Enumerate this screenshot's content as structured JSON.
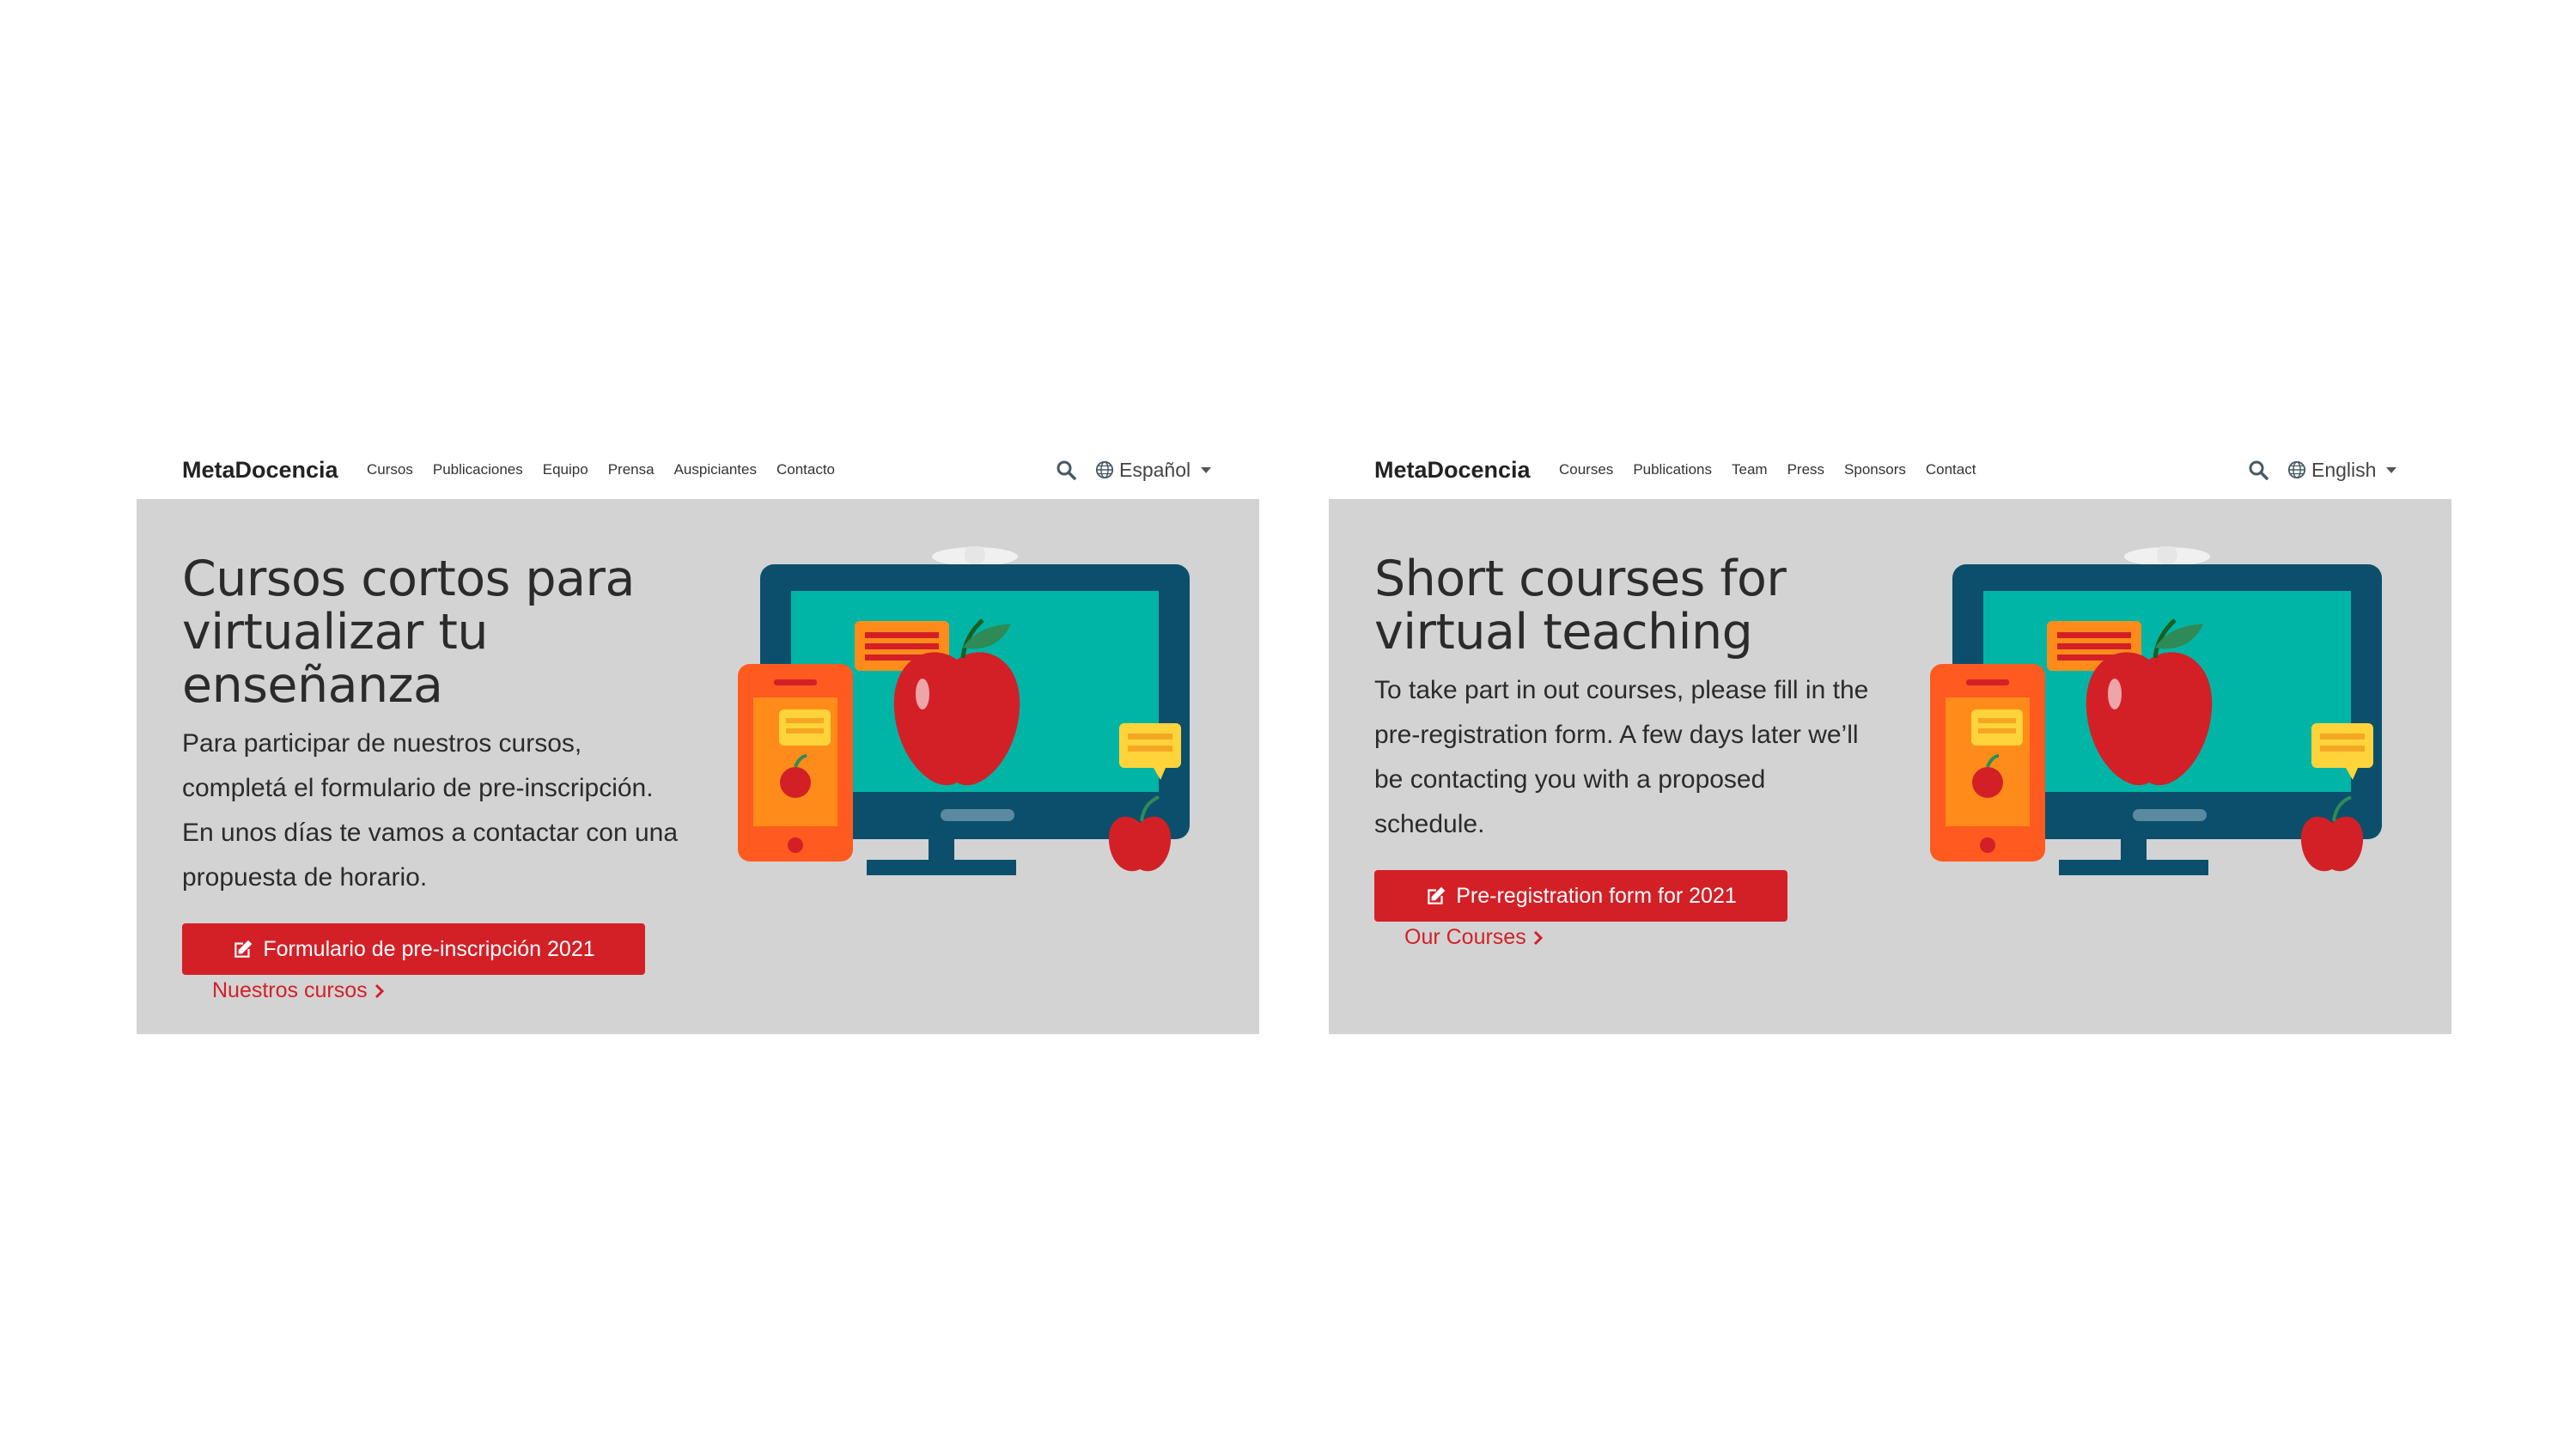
{
  "colors": {
    "page_background": "#ffffff",
    "hero_background": "#d3d3d3",
    "accent_red": "#d32027",
    "monitor_frame": "#0b4f6c",
    "screen_teal": "#00b5a5",
    "phone_orange": "#ff5a1f",
    "bubble_yellow": "#ffd43b",
    "apple_red": "#d32027",
    "leaf_green": "#2e8b57"
  },
  "panels": [
    {
      "id": "es",
      "brand": "MetaDocencia",
      "nav": [
        "Cursos",
        "Publicaciones",
        "Equipo",
        "Prensa",
        "Auspiciantes",
        "Contacto"
      ],
      "search_icon": "search-icon",
      "language": "Español",
      "language_icon": "globe-icon",
      "hero_title": "Cursos cortos para virtualizar tu enseñanza",
      "hero_text": "Para participar de nuestros cursos, completá el formulario de pre-inscripción. En unos días te vamos a contactar con una propuesta de horario.",
      "cta_label": "Formulario de pre-inscripción 2021",
      "cta_icon": "edit-icon",
      "link_label": "Nuestros cursos",
      "link_icon": "chevron-right-icon"
    },
    {
      "id": "en",
      "brand": "MetaDocencia",
      "nav": [
        "Courses",
        "Publications",
        "Team",
        "Press",
        "Sponsors",
        "Contact"
      ],
      "search_icon": "search-icon",
      "language": "English",
      "language_icon": "globe-icon",
      "hero_title": "Short courses for virtual teaching",
      "hero_text": "To take part in out courses, please fill in the pre-registration form. A few days later we’ll be contacting you with a proposed schedule.",
      "cta_label": "Pre-registration form for 2021",
      "cta_icon": "edit-icon",
      "link_label": "Our Courses",
      "link_icon": "chevron-right-icon"
    }
  ]
}
